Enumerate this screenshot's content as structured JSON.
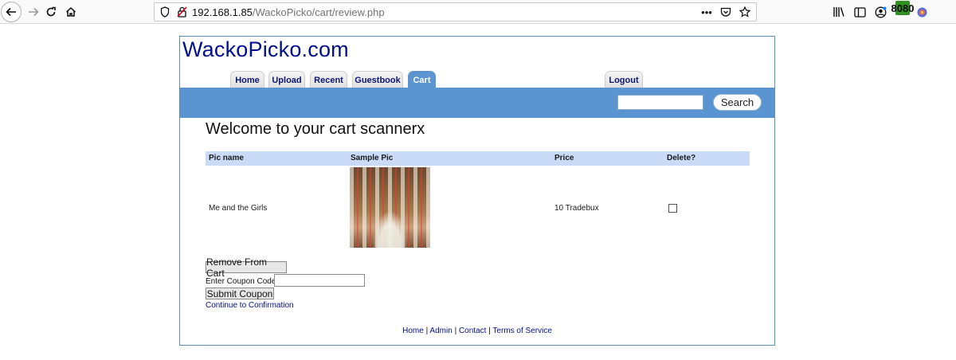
{
  "browser": {
    "url_host": "192.168.1.85",
    "url_path": "/WackoPicko/cart/review.php",
    "proxy_badge": "8080",
    "icons": {
      "back": "back-arrow-icon",
      "forward": "forward-arrow-icon",
      "reload": "reload-icon",
      "home": "home-icon",
      "shield": "shield-icon",
      "insecure": "insecure-lock-icon",
      "more": "more-dots-icon",
      "pocket": "pocket-icon",
      "bookmark": "star-icon",
      "library": "library-icon",
      "sidebar": "sidebar-icon",
      "account": "account-icon",
      "foxyproxy": "foxyproxy-icon",
      "extension": "extension-icon"
    }
  },
  "site": {
    "logo": "WackoPicko.com",
    "tabs": [
      {
        "label": "Home",
        "active": false
      },
      {
        "label": "Upload",
        "active": false
      },
      {
        "label": "Recent",
        "active": false
      },
      {
        "label": "Guestbook",
        "active": false
      },
      {
        "label": "Cart",
        "active": true
      },
      {
        "label": "Logout",
        "active": false
      }
    ],
    "search_button": "Search",
    "search_value": "",
    "heading": "Welcome to your cart scannerx",
    "cart": {
      "columns": [
        "Pic name",
        "Sample Pic",
        "Price",
        "Delete?"
      ],
      "rows": [
        {
          "pic_name": "Me and the Girls",
          "price": "10 Tradebux",
          "delete_checked": false
        }
      ]
    },
    "remove_button": "Remove From Cart",
    "coupon_label": "Enter Coupon Code:",
    "coupon_value": "",
    "submit_coupon_button": "Submit Coupon",
    "continue_link": "Continue to Confirmation",
    "footer": {
      "links": [
        "Home",
        "Admin",
        "Contact",
        "Terms of Service"
      ],
      "separator": "|"
    },
    "colors": {
      "accent": "#5b95d1",
      "header_row": "#c9dbf7",
      "link": "#000f8c"
    }
  }
}
